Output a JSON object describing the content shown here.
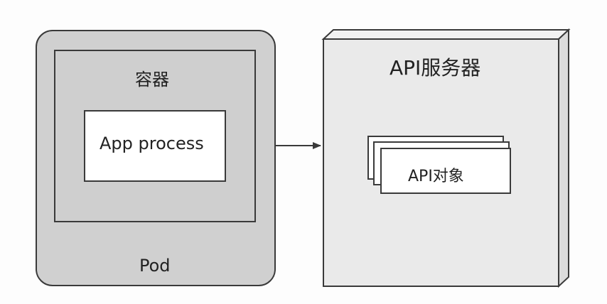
{
  "pod": {
    "label": "Pod"
  },
  "container": {
    "label": "容器"
  },
  "app": {
    "label": "App process"
  },
  "api_server": {
    "label": "API服务器"
  },
  "api_objects": {
    "label": "API对象"
  },
  "colors": {
    "pod_fill": "#d0d0d0",
    "server_fill": "#eaeaea",
    "stroke": "#3a3a3a",
    "box_fill": "#ffffff"
  }
}
